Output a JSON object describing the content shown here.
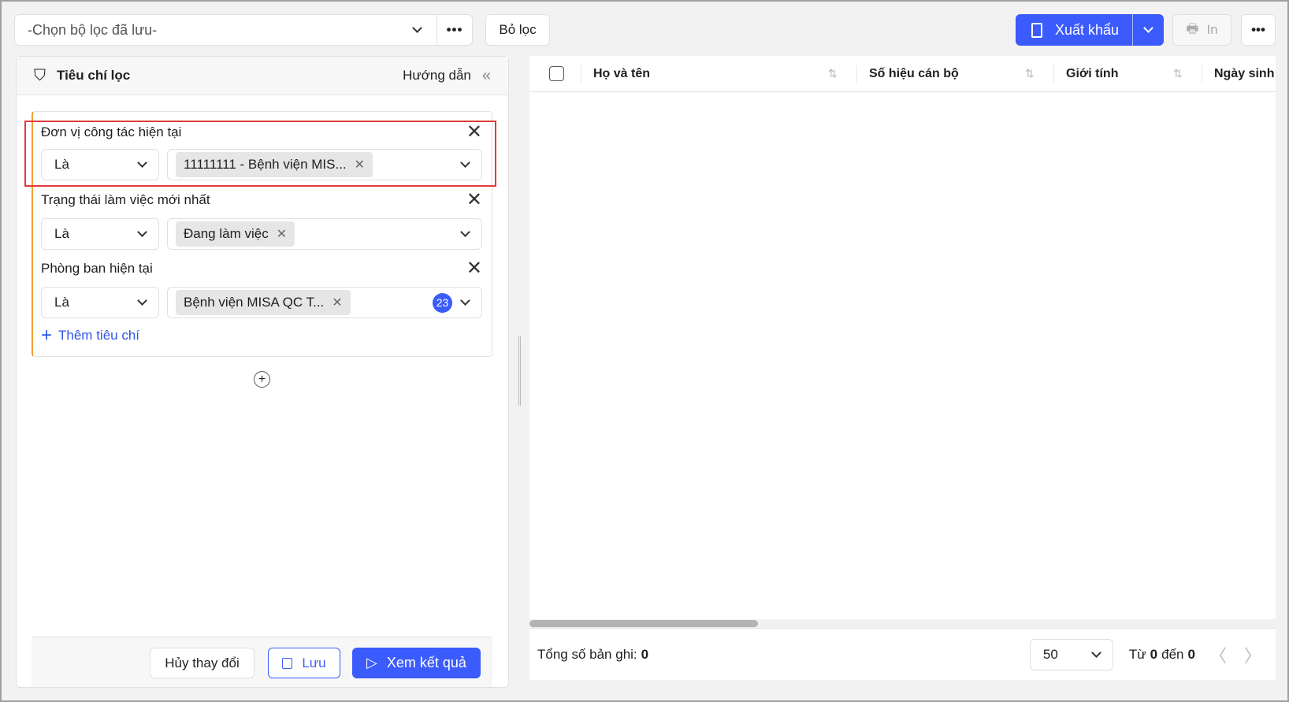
{
  "toolbar": {
    "saved_filter_placeholder": "-Chọn bộ lọc đã lưu-",
    "clear_filter": "Bỏ lọc",
    "export": "Xuất khẩu",
    "print": "In"
  },
  "panel": {
    "title": "Tiêu chí lọc",
    "guide": "Hướng dẫn",
    "criteria": [
      {
        "label": "Đơn vị công tác hiện tại",
        "operator": "Là",
        "tag": "11111111 - Bệnh viện MIS..."
      },
      {
        "label": "Trạng thái làm việc mới nhất",
        "operator": "Là",
        "tag": "Đang làm việc"
      },
      {
        "label": "Phòng ban hiện tại",
        "operator": "Là",
        "tag": "Bệnh viện MISA QC T...",
        "extra_count": "23"
      }
    ],
    "add_criteria": "Thêm tiêu chí",
    "cancel": "Hủy thay đổi",
    "save": "Lưu",
    "view_results": "Xem kết quả"
  },
  "table": {
    "columns": [
      "Họ và tên",
      "Số hiệu cán bộ",
      "Giới tính",
      "Ngày sinh"
    ],
    "footer": {
      "total_label": "Tổng số bản ghi:",
      "total": "0",
      "page_size": "50",
      "from_label": "Từ",
      "from": "0",
      "to_label": "đến",
      "to": "0"
    }
  },
  "colors": {
    "primary": "#3b5bfd",
    "highlight": "#e03a3a",
    "accent_bar": "#f0a030"
  }
}
